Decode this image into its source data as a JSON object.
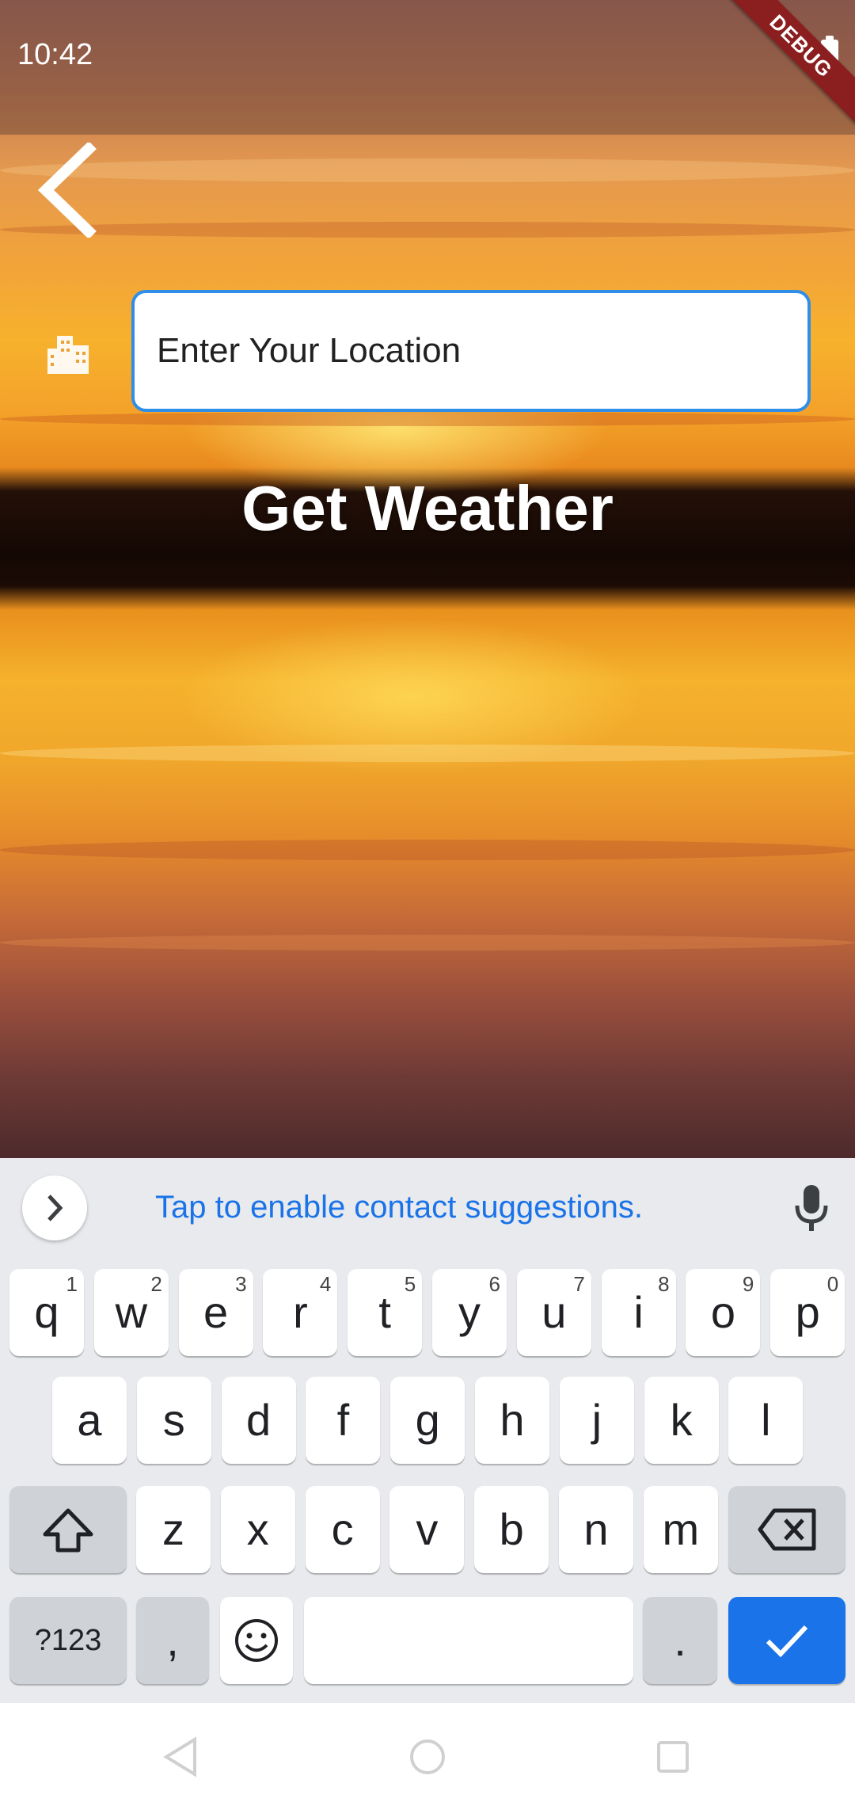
{
  "status_bar": {
    "time": "10:42",
    "debug_label": "DEBUG"
  },
  "location": {
    "placeholder": "Enter Your Location",
    "value": ""
  },
  "action": {
    "label": "Get Weather"
  },
  "keyboard": {
    "suggestion": "Tap to enable contact suggestions.",
    "row1": [
      {
        "key": "q",
        "num": "1"
      },
      {
        "key": "w",
        "num": "2"
      },
      {
        "key": "e",
        "num": "3"
      },
      {
        "key": "r",
        "num": "4"
      },
      {
        "key": "t",
        "num": "5"
      },
      {
        "key": "y",
        "num": "6"
      },
      {
        "key": "u",
        "num": "7"
      },
      {
        "key": "i",
        "num": "8"
      },
      {
        "key": "o",
        "num": "9"
      },
      {
        "key": "p",
        "num": "0"
      }
    ],
    "row2": [
      "a",
      "s",
      "d",
      "f",
      "g",
      "h",
      "j",
      "k",
      "l"
    ],
    "row3": [
      "z",
      "x",
      "c",
      "v",
      "b",
      "n",
      "m"
    ],
    "symbols_key": "?123",
    "comma_key": ",",
    "period_key": "."
  },
  "colors": {
    "accent": "#1a73e8",
    "input_border": "#2e8ee8",
    "debug": "#8b1e1e"
  }
}
